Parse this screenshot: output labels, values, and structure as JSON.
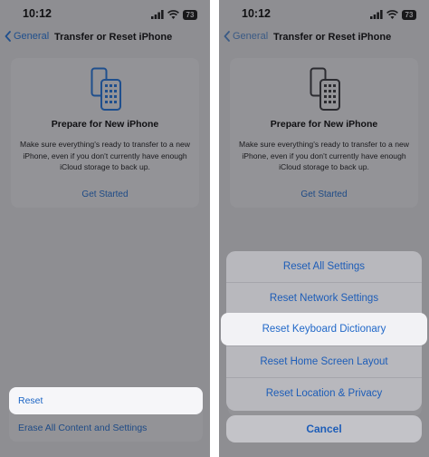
{
  "colors": {
    "accent": "#1d5db8",
    "highlight": "#f6f6f9",
    "dimmed_background": "#8e8e92"
  },
  "left_screen": {
    "status": {
      "time": "10:12",
      "battery": "73"
    },
    "nav": {
      "back_label": "General",
      "title": "Transfer or Reset iPhone"
    },
    "card": {
      "icon": "iphone-transfer-icon",
      "title": "Prepare for New iPhone",
      "description": "Make sure everything's ready to transfer to a new iPhone, even if you don't currently have enough iCloud storage to back up.",
      "action": "Get Started"
    },
    "list": [
      {
        "label": "Reset",
        "highlighted": true
      },
      {
        "label": "Erase All Content and Settings",
        "highlighted": false
      }
    ]
  },
  "right_screen": {
    "status": {
      "time": "10:12",
      "battery": "73"
    },
    "nav": {
      "back_label": "General",
      "title": "Transfer or Reset iPhone"
    },
    "card": {
      "icon": "iphone-transfer-icon",
      "title": "Prepare for New iPhone",
      "description": "Make sure everything's ready to transfer to a new iPhone, even if you don't currently have enough iCloud storage to back up.",
      "action": "Get Started"
    },
    "reset_sheet": {
      "options": [
        "Reset All Settings",
        "Reset Network Settings",
        "Reset Keyboard Dictionary",
        "Reset Home Screen Layout",
        "Reset Location & Privacy"
      ],
      "highlighted_index": 2,
      "cancel": "Cancel"
    }
  }
}
